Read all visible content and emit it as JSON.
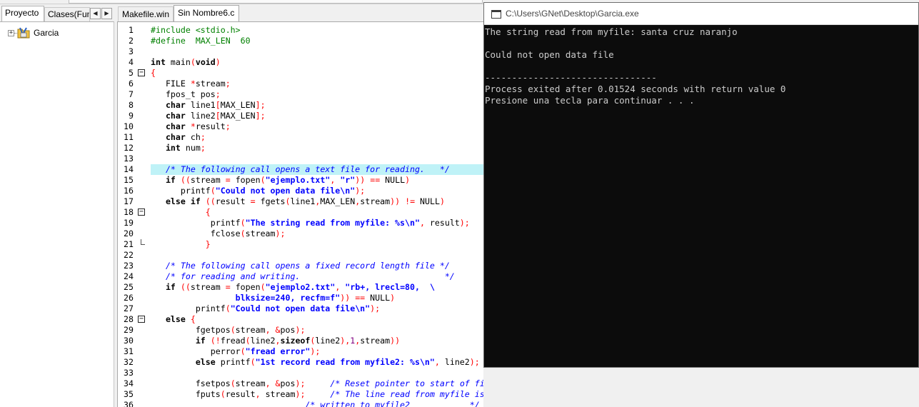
{
  "left_panel": {
    "tabs": [
      {
        "label": "Proyecto",
        "active": true
      },
      {
        "label": "Clases(Fun",
        "active": false
      }
    ],
    "arrows": [
      "◀",
      "▶"
    ],
    "tree": {
      "expander": "+",
      "project": "Garcia"
    }
  },
  "editor_tabs": [
    {
      "label": "Makefile.win",
      "active": false
    },
    {
      "label": "Sin Nombre6.c",
      "active": true
    }
  ],
  "editor": {
    "highlight_line": 14,
    "fold_start_lines": [
      5,
      18,
      28
    ],
    "fold_end_lines": [
      21
    ],
    "lines": [
      {
        "n": "1",
        "tokens": [
          {
            "t": "pp",
            "v": "#include <stdio.h>"
          }
        ]
      },
      {
        "n": "2",
        "tokens": [
          {
            "t": "pp",
            "v": "#define  MAX_LEN  60"
          }
        ]
      },
      {
        "n": "3",
        "tokens": []
      },
      {
        "n": "4",
        "tokens": [
          {
            "t": "kw",
            "v": "int"
          },
          {
            "t": "",
            "v": " main"
          },
          {
            "t": "sym",
            "v": "("
          },
          {
            "t": "kw",
            "v": "void"
          },
          {
            "t": "sym",
            "v": ")"
          }
        ]
      },
      {
        "n": "5",
        "tokens": [
          {
            "t": "sym",
            "v": "{"
          }
        ]
      },
      {
        "n": "6",
        "tokens": [
          {
            "t": "",
            "v": "   FILE "
          },
          {
            "t": "sym",
            "v": "*"
          },
          {
            "t": "",
            "v": "stream"
          },
          {
            "t": "sym",
            "v": ";"
          }
        ]
      },
      {
        "n": "7",
        "tokens": [
          {
            "t": "",
            "v": "   fpos_t pos"
          },
          {
            "t": "sym",
            "v": ";"
          }
        ]
      },
      {
        "n": "8",
        "tokens": [
          {
            "t": "kw",
            "v": "   char"
          },
          {
            "t": "",
            "v": " line1"
          },
          {
            "t": "sym",
            "v": "["
          },
          {
            "t": "",
            "v": "MAX_LEN"
          },
          {
            "t": "sym",
            "v": "];"
          }
        ]
      },
      {
        "n": "9",
        "tokens": [
          {
            "t": "kw",
            "v": "   char"
          },
          {
            "t": "",
            "v": " line2"
          },
          {
            "t": "sym",
            "v": "["
          },
          {
            "t": "",
            "v": "MAX_LEN"
          },
          {
            "t": "sym",
            "v": "];"
          }
        ]
      },
      {
        "n": "10",
        "tokens": [
          {
            "t": "kw",
            "v": "   char"
          },
          {
            "t": "",
            "v": " "
          },
          {
            "t": "sym",
            "v": "*"
          },
          {
            "t": "",
            "v": "result"
          },
          {
            "t": "sym",
            "v": ";"
          }
        ]
      },
      {
        "n": "11",
        "tokens": [
          {
            "t": "kw",
            "v": "   char"
          },
          {
            "t": "",
            "v": " ch"
          },
          {
            "t": "sym",
            "v": ";"
          }
        ]
      },
      {
        "n": "12",
        "tokens": [
          {
            "t": "kw",
            "v": "   int"
          },
          {
            "t": "",
            "v": " num"
          },
          {
            "t": "sym",
            "v": ";"
          }
        ]
      },
      {
        "n": "13",
        "tokens": []
      },
      {
        "n": "14",
        "tokens": [
          {
            "t": "cm",
            "v": "   /* The following call opens a text file for reading.   */"
          }
        ]
      },
      {
        "n": "15",
        "tokens": [
          {
            "t": "kw",
            "v": "   if"
          },
          {
            "t": "",
            "v": " "
          },
          {
            "t": "sym",
            "v": "(("
          },
          {
            "t": "",
            "v": "stream "
          },
          {
            "t": "sym",
            "v": "="
          },
          {
            "t": "",
            "v": " fopen"
          },
          {
            "t": "sym",
            "v": "("
          },
          {
            "t": "str",
            "v": "\"ejemplo.txt\""
          },
          {
            "t": "sym",
            "v": ","
          },
          {
            "t": "",
            "v": " "
          },
          {
            "t": "str",
            "v": "\"r\""
          },
          {
            "t": "sym",
            "v": "))"
          },
          {
            "t": "",
            "v": " "
          },
          {
            "t": "sym",
            "v": "=="
          },
          {
            "t": "",
            "v": " NULL"
          },
          {
            "t": "sym",
            "v": ")"
          }
        ]
      },
      {
        "n": "16",
        "tokens": [
          {
            "t": "",
            "v": "      printf"
          },
          {
            "t": "sym",
            "v": "("
          },
          {
            "t": "str",
            "v": "\"Could not open data file\\n\""
          },
          {
            "t": "sym",
            "v": ");"
          }
        ]
      },
      {
        "n": "17",
        "tokens": [
          {
            "t": "kw",
            "v": "   else if"
          },
          {
            "t": "",
            "v": " "
          },
          {
            "t": "sym",
            "v": "(("
          },
          {
            "t": "",
            "v": "result "
          },
          {
            "t": "sym",
            "v": "="
          },
          {
            "t": "",
            "v": " fgets"
          },
          {
            "t": "sym",
            "v": "("
          },
          {
            "t": "",
            "v": "line1"
          },
          {
            "t": "sym",
            "v": ","
          },
          {
            "t": "",
            "v": "MAX_LEN"
          },
          {
            "t": "sym",
            "v": ","
          },
          {
            "t": "",
            "v": "stream"
          },
          {
            "t": "sym",
            "v": "))"
          },
          {
            "t": "",
            "v": " "
          },
          {
            "t": "sym",
            "v": "!="
          },
          {
            "t": "",
            "v": " NULL"
          },
          {
            "t": "sym",
            "v": ")"
          }
        ]
      },
      {
        "n": "18",
        "tokens": [
          {
            "t": "sym",
            "v": "           {"
          }
        ]
      },
      {
        "n": "19",
        "tokens": [
          {
            "t": "",
            "v": "            printf"
          },
          {
            "t": "sym",
            "v": "("
          },
          {
            "t": "str",
            "v": "\"The string read from myfile: %s\\n\""
          },
          {
            "t": "sym",
            "v": ","
          },
          {
            "t": "",
            "v": " result"
          },
          {
            "t": "sym",
            "v": ");"
          }
        ]
      },
      {
        "n": "20",
        "tokens": [
          {
            "t": "",
            "v": "            fclose"
          },
          {
            "t": "sym",
            "v": "("
          },
          {
            "t": "",
            "v": "stream"
          },
          {
            "t": "sym",
            "v": ");"
          }
        ]
      },
      {
        "n": "21",
        "tokens": [
          {
            "t": "sym",
            "v": "           }"
          }
        ]
      },
      {
        "n": "22",
        "tokens": []
      },
      {
        "n": "23",
        "tokens": [
          {
            "t": "cm",
            "v": "   /* The following call opens a fixed record length file */"
          }
        ]
      },
      {
        "n": "24",
        "tokens": [
          {
            "t": "cm",
            "v": "   /* for reading and writing.                             */"
          }
        ]
      },
      {
        "n": "25",
        "tokens": [
          {
            "t": "kw",
            "v": "   if"
          },
          {
            "t": "",
            "v": " "
          },
          {
            "t": "sym",
            "v": "(("
          },
          {
            "t": "",
            "v": "stream "
          },
          {
            "t": "sym",
            "v": "="
          },
          {
            "t": "",
            "v": " fopen"
          },
          {
            "t": "sym",
            "v": "("
          },
          {
            "t": "str",
            "v": "\"ejemplo2.txt\""
          },
          {
            "t": "sym",
            "v": ","
          },
          {
            "t": "",
            "v": " "
          },
          {
            "t": "str",
            "v": "\"rb+, lrecl=80,  \\"
          }
        ]
      },
      {
        "n": "26",
        "tokens": [
          {
            "t": "str",
            "v": "                 blksize=240, recfm=f\""
          },
          {
            "t": "sym",
            "v": "))"
          },
          {
            "t": "",
            "v": " "
          },
          {
            "t": "sym",
            "v": "=="
          },
          {
            "t": "",
            "v": " NULL"
          },
          {
            "t": "sym",
            "v": ")"
          }
        ]
      },
      {
        "n": "27",
        "tokens": [
          {
            "t": "",
            "v": "         printf"
          },
          {
            "t": "sym",
            "v": "("
          },
          {
            "t": "str",
            "v": "\"Could not open data file\\n\""
          },
          {
            "t": "sym",
            "v": ");"
          }
        ]
      },
      {
        "n": "28",
        "tokens": [
          {
            "t": "kw",
            "v": "   else"
          },
          {
            "t": "",
            "v": " "
          },
          {
            "t": "sym",
            "v": "{"
          }
        ]
      },
      {
        "n": "29",
        "tokens": [
          {
            "t": "",
            "v": "         fgetpos"
          },
          {
            "t": "sym",
            "v": "("
          },
          {
            "t": "",
            "v": "stream"
          },
          {
            "t": "sym",
            "v": ","
          },
          {
            "t": "",
            "v": " "
          },
          {
            "t": "sym",
            "v": "&"
          },
          {
            "t": "",
            "v": "pos"
          },
          {
            "t": "sym",
            "v": ");"
          }
        ]
      },
      {
        "n": "30",
        "tokens": [
          {
            "t": "kw",
            "v": "         if"
          },
          {
            "t": "",
            "v": " "
          },
          {
            "t": "sym",
            "v": "(!"
          },
          {
            "t": "",
            "v": "fread"
          },
          {
            "t": "sym",
            "v": "("
          },
          {
            "t": "",
            "v": "line2"
          },
          {
            "t": "sym",
            "v": ","
          },
          {
            "t": "kw",
            "v": "sizeof"
          },
          {
            "t": "sym",
            "v": "("
          },
          {
            "t": "",
            "v": "line2"
          },
          {
            "t": "sym",
            "v": "),"
          },
          {
            "t": "num",
            "v": "1"
          },
          {
            "t": "sym",
            "v": ","
          },
          {
            "t": "",
            "v": "stream"
          },
          {
            "t": "sym",
            "v": "))"
          }
        ]
      },
      {
        "n": "31",
        "tokens": [
          {
            "t": "",
            "v": "            perror"
          },
          {
            "t": "sym",
            "v": "("
          },
          {
            "t": "str",
            "v": "\"fread error\""
          },
          {
            "t": "sym",
            "v": ");"
          }
        ]
      },
      {
        "n": "32",
        "tokens": [
          {
            "t": "kw",
            "v": "         else"
          },
          {
            "t": "",
            "v": " printf"
          },
          {
            "t": "sym",
            "v": "("
          },
          {
            "t": "str",
            "v": "\"1st record read from myfile2: %s\\n\""
          },
          {
            "t": "sym",
            "v": ","
          },
          {
            "t": "",
            "v": " line2"
          },
          {
            "t": "sym",
            "v": ");"
          }
        ]
      },
      {
        "n": "33",
        "tokens": []
      },
      {
        "n": "34",
        "tokens": [
          {
            "t": "",
            "v": "         fsetpos"
          },
          {
            "t": "sym",
            "v": "("
          },
          {
            "t": "",
            "v": "stream"
          },
          {
            "t": "sym",
            "v": ","
          },
          {
            "t": "",
            "v": " "
          },
          {
            "t": "sym",
            "v": "&"
          },
          {
            "t": "",
            "v": "pos"
          },
          {
            "t": "sym",
            "v": ");"
          },
          {
            "t": "",
            "v": "     "
          },
          {
            "t": "cm",
            "v": "/* Reset pointer to start of file */"
          }
        ]
      },
      {
        "n": "35",
        "tokens": [
          {
            "t": "",
            "v": "         fputs"
          },
          {
            "t": "sym",
            "v": "("
          },
          {
            "t": "",
            "v": "result"
          },
          {
            "t": "sym",
            "v": ","
          },
          {
            "t": "",
            "v": " stream"
          },
          {
            "t": "sym",
            "v": ");"
          },
          {
            "t": "",
            "v": "     "
          },
          {
            "t": "cm",
            "v": "/* The line read from myfile is   */"
          }
        ]
      },
      {
        "n": "36",
        "tokens": [
          {
            "t": "",
            "v": "                               "
          },
          {
            "t": "cm",
            "v": "/* written to myfile2            */"
          }
        ]
      }
    ]
  },
  "console": {
    "title": "C:\\Users\\GNet\\Desktop\\Garcia.exe",
    "lines": [
      "The string read from myfile: santa cruz naranjo",
      "",
      "Could not open data file",
      "",
      "--------------------------------",
      "Process exited after 0.01524 seconds with return value 0",
      "Presione una tecla para continuar . . ."
    ]
  }
}
